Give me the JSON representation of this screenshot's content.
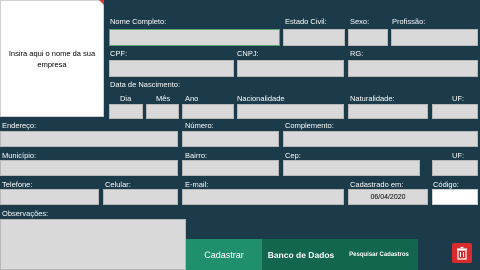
{
  "company_placeholder": "Insira aqui o nome da sua empresa",
  "labels": {
    "nome_completo": "Nome Completo:",
    "estado_civil": "Estado Civil:",
    "sexo": "Sexo:",
    "profissao": "Profissão:",
    "cpf": "CPF:",
    "cnpj": "CNPJ:",
    "rg": "RG:",
    "data_nascimento": "Data de Nascimento:",
    "dia": "Dia",
    "mes": "Mês",
    "ano": "Ano",
    "nacionalidade": "Nacionalidade",
    "naturalidade": "Naturalidade:",
    "uf": "UF:",
    "endereco": "Endereço:",
    "numero": "Número:",
    "complemento": "Complemento:",
    "municipio": "Município:",
    "bairro": "Bairro:",
    "cep": "Cep:",
    "uf2": "UF:",
    "telefone": "Telefone:",
    "celular": "Celular:",
    "email": "E-mail:",
    "cadastrado_em": "Cadastrado em:",
    "codigo": "Código:",
    "observacoes": "Observações:"
  },
  "values": {
    "cadastrado_em": "06/04/2020"
  },
  "buttons": {
    "cadastrar": "Cadastrar",
    "banco_de_dados": "Banco de Dados",
    "pesquisar_cadastros": "Pesquisar Cadastros"
  },
  "icons": {
    "delete": "trash-icon"
  },
  "colors": {
    "background": "#1b3a4a",
    "field": "#d9d9d9",
    "button_green": "#1f8f6e",
    "button_dark": "#12664d",
    "delete": "#d92b2b"
  }
}
